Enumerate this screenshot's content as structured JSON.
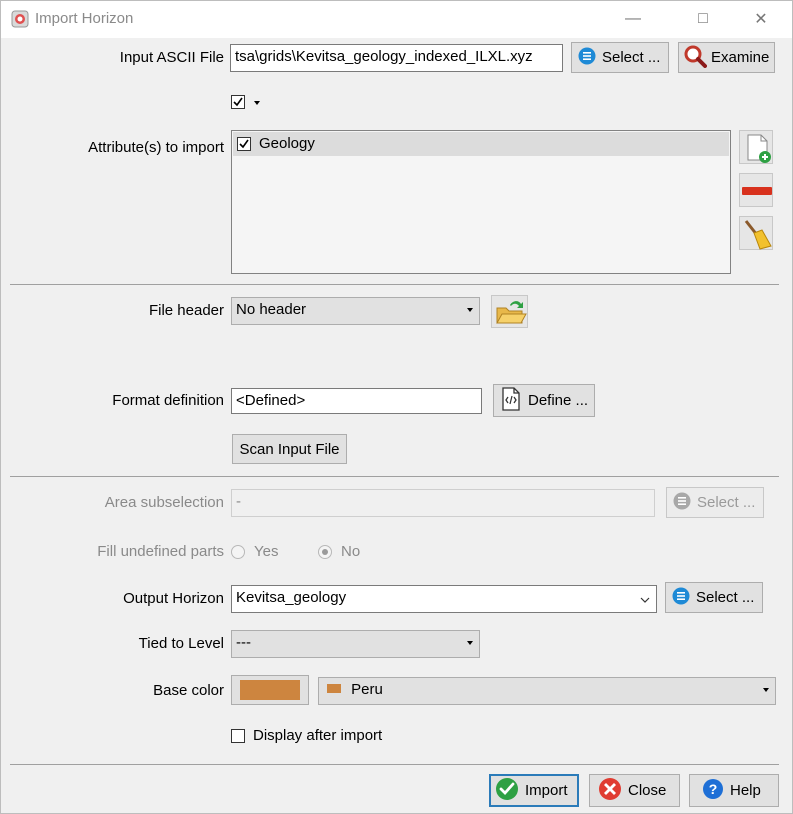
{
  "window": {
    "title": "Import Horizon"
  },
  "input_file": {
    "label": "Input ASCII File",
    "value": "tsa\\grids\\Kevitsa_geology_indexed_ILXL.xyz",
    "select_label": "Select ...",
    "examine_label": "Examine"
  },
  "attributes": {
    "label": "Attribute(s) to import",
    "items": [
      {
        "name": "Geology",
        "checked": true
      }
    ]
  },
  "file_header": {
    "label": "File header",
    "value": "No header"
  },
  "format": {
    "label": "Format definition",
    "value": "<Defined>",
    "define_label": "Define ..."
  },
  "scan_label": "Scan Input File",
  "area": {
    "label": "Area subselection",
    "value": "-",
    "select_label": "Select ..."
  },
  "fill": {
    "label": "Fill undefined parts",
    "yes": "Yes",
    "no": "No",
    "selected": "No"
  },
  "output": {
    "label": "Output Horizon",
    "value": "Kevitsa_geology",
    "select_label": "Select ..."
  },
  "tied": {
    "label": "Tied to Level",
    "value": "---"
  },
  "base_color": {
    "label": "Base color",
    "color_name": "Peru",
    "color_hex": "#cd853f"
  },
  "display_after": {
    "label": "Display after import",
    "checked": false
  },
  "footer": {
    "import_label": "Import",
    "close_label": "Close",
    "help_label": "Help"
  }
}
